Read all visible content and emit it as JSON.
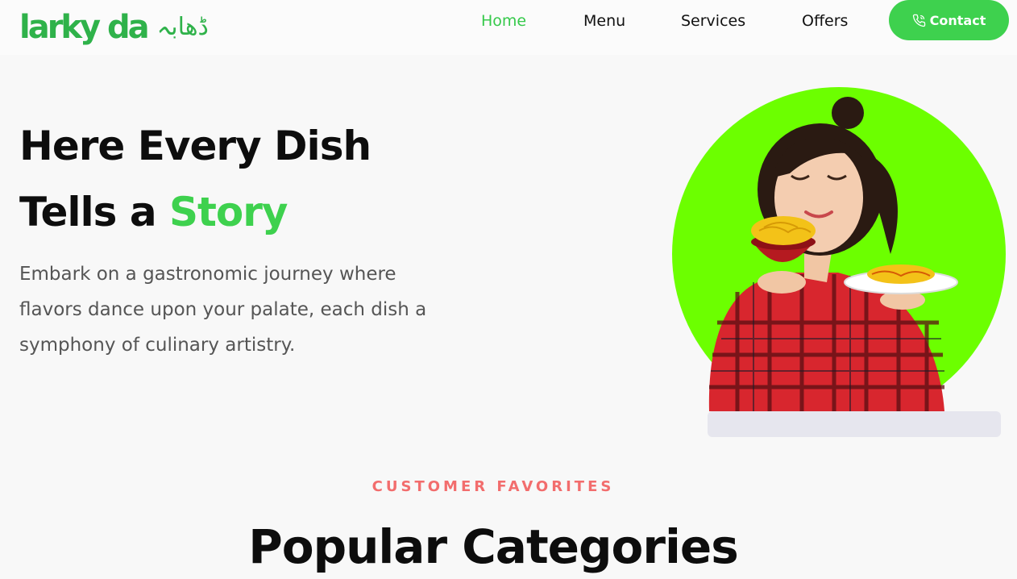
{
  "brand": {
    "name_latin": "larky da",
    "name_urdu": "ڈھابہ",
    "color": "#2fb24a"
  },
  "nav": {
    "items": [
      {
        "label": "Home",
        "active": true
      },
      {
        "label": "Menu",
        "active": false
      },
      {
        "label": "Services",
        "active": false
      },
      {
        "label": "Offers",
        "active": false
      }
    ],
    "contact_label": "Contact",
    "contact_icon": "phone-icon",
    "accent": "#3ed14e"
  },
  "hero": {
    "title_line1": "Here Every Dish",
    "title_line2_prefix": "Tells a ",
    "title_line2_accent": "Story",
    "description": "Embark on a gastronomic journey where flavors dance upon your palate, each dish a symphony of culinary artistry.",
    "image_subject": "woman-holding-noodle-bowl-and-plate",
    "circle_color": "#6cff00"
  },
  "favorites": {
    "eyebrow": "CUSTOMER FAVORITES",
    "title": "Popular Categories",
    "eyebrow_color": "#f26d6d"
  }
}
